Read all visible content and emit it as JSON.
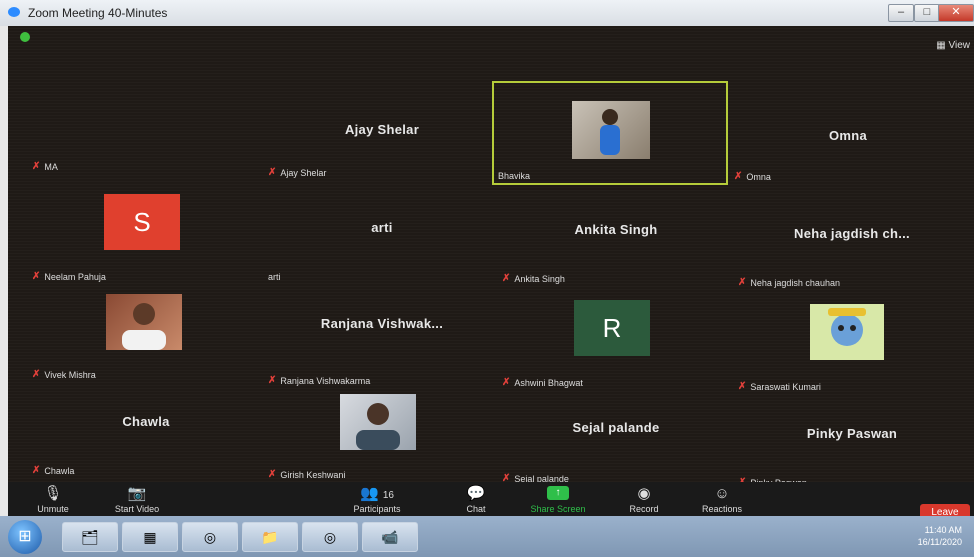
{
  "window": {
    "title": "Zoom Meeting 40-Minutes"
  },
  "controls": {
    "minimize": "–",
    "maximize": "□",
    "close": "✕"
  },
  "meeting": {
    "view_label": "View",
    "tiles": [
      {
        "id": "ma",
        "big": "",
        "footer": "MA"
      },
      {
        "id": "ajay",
        "big": "Ajay Shelar",
        "footer": "Ajay Shelar"
      },
      {
        "id": "bhavika",
        "big": "",
        "footer": "Bhavika"
      },
      {
        "id": "omna",
        "big": "Omna",
        "footer": "Omna"
      },
      {
        "id": "neelam",
        "big": "",
        "footer": "Neelam Pahuja",
        "avatar": "S"
      },
      {
        "id": "arti",
        "big": "arti",
        "footer": "arti"
      },
      {
        "id": "ankita",
        "big": "Ankita Singh",
        "footer": "Ankita Singh"
      },
      {
        "id": "neha",
        "big": "Neha jagdish ch...",
        "footer": "Neha jagdish chauhan"
      },
      {
        "id": "vivek",
        "big": "",
        "footer": "Vivek Mishra"
      },
      {
        "id": "ranjana",
        "big": "Ranjana Vishwak...",
        "footer": "Ranjana Vishwakarma"
      },
      {
        "id": "ashwini",
        "big": "",
        "footer": "Ashwini Bhagwat",
        "avatar": "R"
      },
      {
        "id": "saraswati",
        "big": "",
        "footer": "Saraswati Kumari"
      },
      {
        "id": "chawla",
        "big": "Chawla",
        "footer": "Chawla"
      },
      {
        "id": "girish",
        "big": "",
        "footer": "Girish Keshwani"
      },
      {
        "id": "sejal",
        "big": "Sejal palande",
        "footer": "Sejal palande"
      },
      {
        "id": "pinky",
        "big": "Pinky Paswan",
        "footer": "Pinky Paswan"
      }
    ]
  },
  "toolbar": {
    "unmute": "Unmute",
    "start_video": "Start Video",
    "participants": "Participants",
    "participants_count": "16",
    "chat": "Chat",
    "share_screen": "Share Screen",
    "record": "Record",
    "reactions": "Reactions",
    "leave": "Leave"
  },
  "taskbar": {
    "time": "11:40 AM",
    "date": "16/11/2020"
  },
  "colors": {
    "accent_green": "#2fbf4a",
    "active_border": "#b5cc3a",
    "leave_red": "#d9382c",
    "avatar_s": "#e0402e",
    "avatar_r": "#2c5a3c"
  }
}
